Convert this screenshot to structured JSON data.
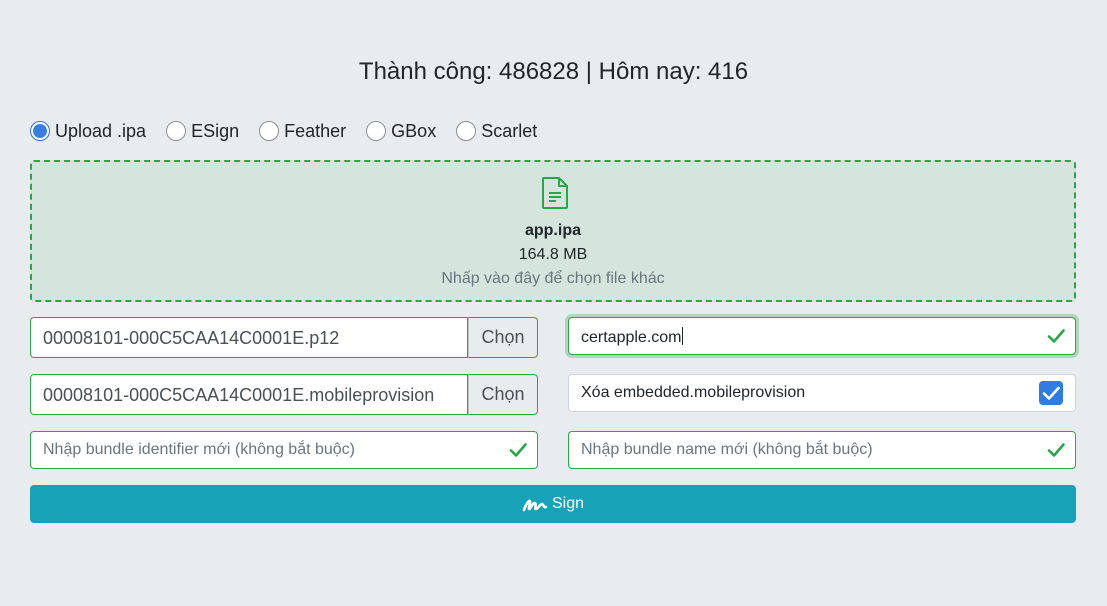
{
  "stats": {
    "text": "Thành công: 486828 | Hôm nay: 416"
  },
  "modes": [
    {
      "label": "Upload .ipa",
      "checked": true
    },
    {
      "label": "ESign",
      "checked": false
    },
    {
      "label": "Feather",
      "checked": false
    },
    {
      "label": "GBox",
      "checked": false
    },
    {
      "label": "Scarlet",
      "checked": false
    }
  ],
  "upload": {
    "icon": "file-icon",
    "file_name": "app.ipa",
    "file_size": "164.8 MB",
    "hint": "Nhấp vào đây để chọn file khác"
  },
  "p12": {
    "value": "00008101-000C5CAA14C0001E.p12",
    "button": "Chọn"
  },
  "provision": {
    "value": "00008101-000C5CAA14C0001E.mobileprovision",
    "button": "Chọn"
  },
  "password": {
    "value": "certapple.com",
    "valid_icon": "check-icon"
  },
  "remove_embedded": {
    "label": "Xóa embedded.mobileprovision",
    "checked": true
  },
  "bundle_id": {
    "placeholder": "Nhập bundle identifier mới (không bắt buộc)",
    "valid_icon": "check-icon"
  },
  "bundle_name": {
    "placeholder": "Nhập bundle name mới (không bắt buộc)",
    "valid_icon": "check-icon"
  },
  "sign_button": {
    "label": "Sign",
    "icon": "signature-icon",
    "color": "#17a2b8"
  },
  "colors": {
    "success": "#28a745",
    "accent": "#3a7ee4",
    "background": "#e9ecef"
  }
}
